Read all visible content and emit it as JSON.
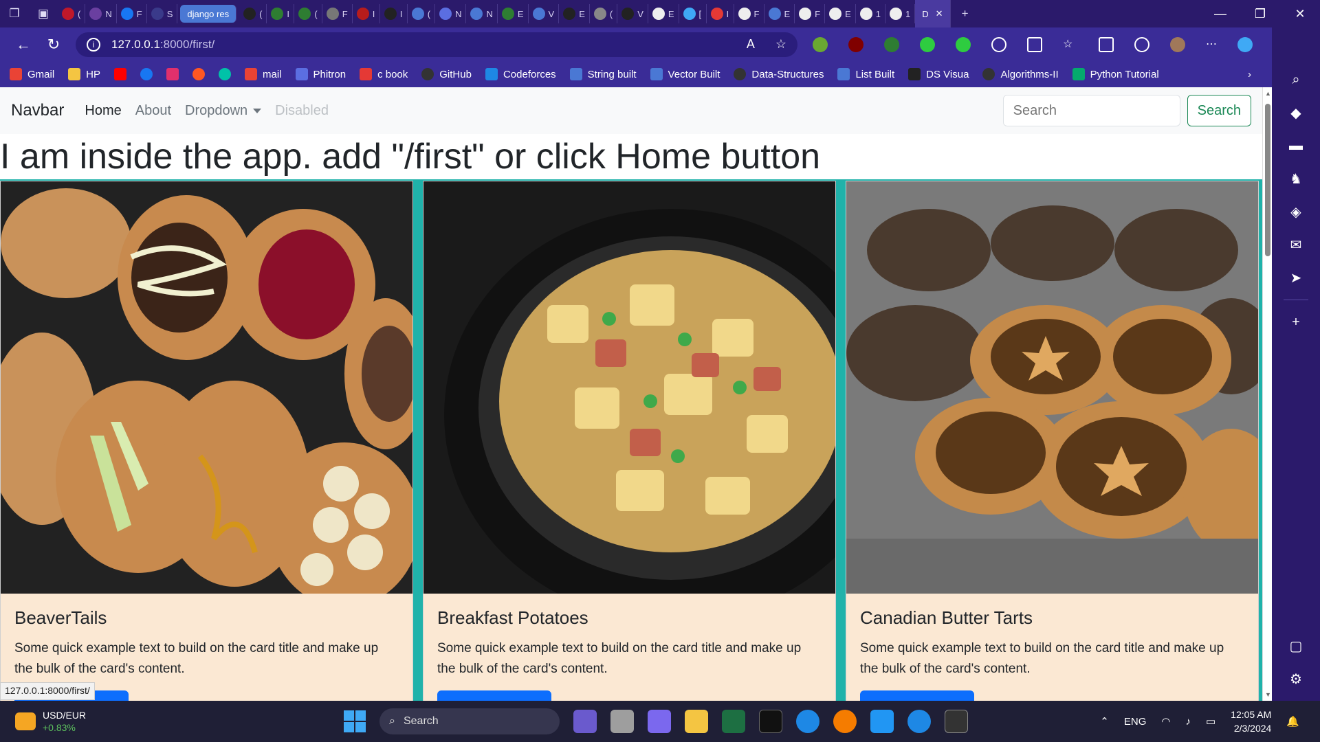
{
  "tabs": {
    "highlighted": "django res",
    "active": "D",
    "others": [
      "(",
      "N",
      "F",
      "S",
      "(",
      "I",
      "(",
      "F",
      "I",
      "I",
      "(",
      "N",
      "N",
      "E",
      "V",
      "E",
      "(",
      "V",
      "E",
      "[",
      "I",
      "F",
      "E",
      "F",
      "E",
      "1",
      "1",
      "D"
    ]
  },
  "address": {
    "host": "127.0.0.1",
    "path": ":8000/first/"
  },
  "bookmarks": [
    {
      "label": "Gmail",
      "color": "#ea4335"
    },
    {
      "label": "HP",
      "color": "#f4c542"
    },
    {
      "label": "",
      "color": "#ff0000"
    },
    {
      "label": "",
      "color": "#1877f2"
    },
    {
      "label": "",
      "color": "#e1306c"
    },
    {
      "label": "",
      "color": "#ff5722"
    },
    {
      "label": "",
      "color": "#00c2a8"
    },
    {
      "label": "mail",
      "color": "#ea4335"
    },
    {
      "label": "Phitron",
      "color": "#5b6ee1"
    },
    {
      "label": "c book",
      "color": "#e53935"
    },
    {
      "label": "GitHub",
      "color": "#333333"
    },
    {
      "label": "Codeforces",
      "color": "#1e88e5"
    },
    {
      "label": "String built",
      "color": "#4a78d4"
    },
    {
      "label": "Vector Built",
      "color": "#4a78d4"
    },
    {
      "label": "Data-Structures",
      "color": "#333333"
    },
    {
      "label": "List Built",
      "color": "#4a78d4"
    },
    {
      "label": "DS Visua",
      "color": "#222222"
    },
    {
      "label": "Algorithms-II",
      "color": "#333333"
    },
    {
      "label": "Python Tutorial",
      "color": "#04aa6d"
    }
  ],
  "navbar": {
    "brand": "Navbar",
    "home": "Home",
    "about": "About",
    "dropdown": "Dropdown",
    "disabled": "Disabled",
    "search_placeholder": "Search",
    "search_button": "Search"
  },
  "heading": "I am inside the app. add \"/first\" or click Home button",
  "cards": [
    {
      "title": "BeaverTails",
      "text": "Some quick example text to build on the card title and make up the bulk of the card's content."
    },
    {
      "title": "Breakfast Potatoes",
      "text": "Some quick example text to build on the card title and make up the bulk of the card's content."
    },
    {
      "title": "Canadian Butter Tarts",
      "text": "Some quick example text to build on the card title and make up the bulk of the card's content."
    }
  ],
  "status_url": "127.0.0.1:8000/first/",
  "taskbar": {
    "ticker": "USD/EUR",
    "ticker_change": "+0.83%",
    "search": "Search",
    "language": "ENG",
    "time": "12:05 AM",
    "date": "2/3/2024"
  },
  "colors": {
    "accent": "#20b2aa",
    "card_bg": "#fbe8d3",
    "button": "#0d6efd",
    "browser_frame": "#3a2c97"
  }
}
